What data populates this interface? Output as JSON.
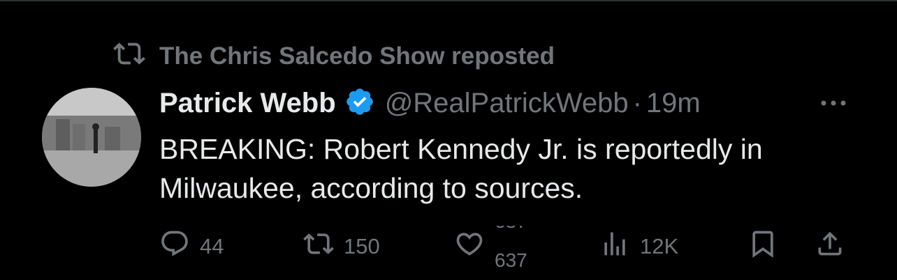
{
  "repost": {
    "label": "The Chris Salcedo Show reposted"
  },
  "tweet": {
    "author_name": "Patrick Webb",
    "handle": "@RealPatrickWebb",
    "separator": "·",
    "time": "19m",
    "text_line1": "BREAKING: Robert Kennedy Jr. is reportedly in",
    "text_line2": "Milwaukee, according to sources."
  },
  "actions": {
    "replies": "44",
    "reposts": "150",
    "likes_old": "637",
    "likes_new": "637",
    "views": "12K"
  },
  "colors": {
    "accent": "#1d9bf0",
    "muted": "#71767b",
    "text": "#e7e9ea",
    "background": "#000000"
  },
  "icons": [
    "repost-icon",
    "verified-badge-icon",
    "more-icon",
    "reply-icon",
    "retweet-icon",
    "like-icon",
    "views-icon",
    "bookmark-icon",
    "share-icon"
  ]
}
